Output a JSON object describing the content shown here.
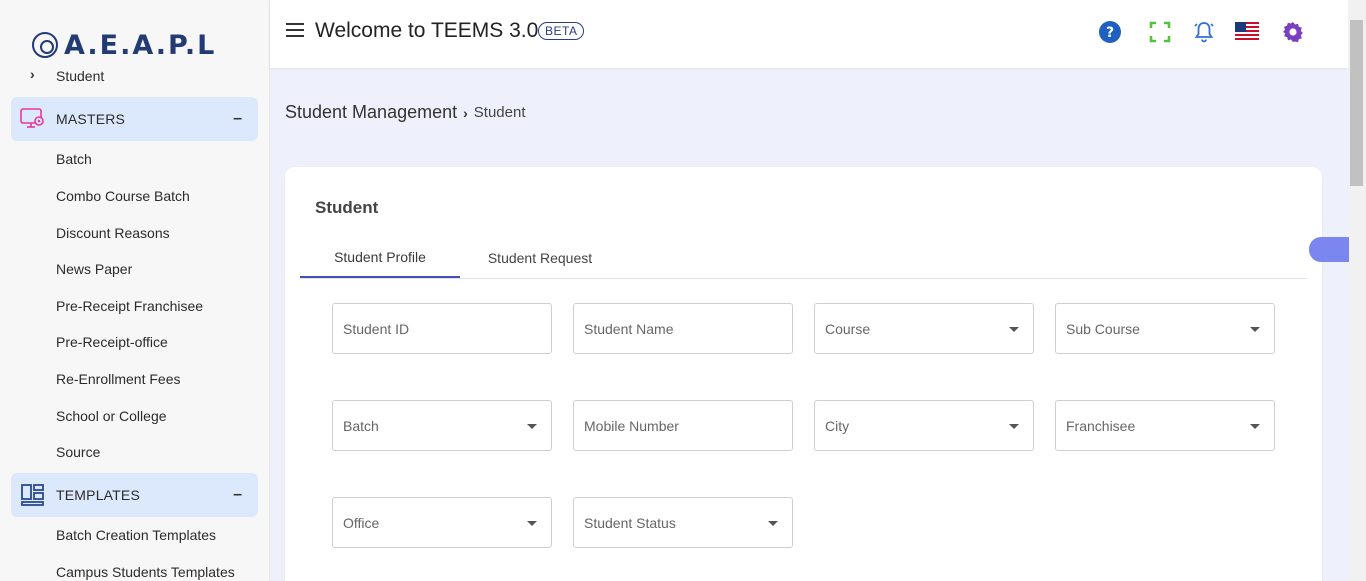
{
  "sidebar": {
    "logo_text": "A.E.A.P.L",
    "top_item": "Student",
    "masters": {
      "label": "MASTERS",
      "collapse": "–",
      "items": [
        "Batch",
        "Combo Course Batch",
        "Discount Reasons",
        "News Paper",
        "Pre-Receipt Franchisee",
        "Pre-Receipt-office",
        "Re-Enrollment Fees",
        "School or College",
        "Source"
      ]
    },
    "templates": {
      "label": "TEMPLATES",
      "collapse": "–",
      "items": [
        "Batch Creation Templates",
        "Campus Students Templates"
      ]
    }
  },
  "header": {
    "title": "Welcome to TEEMS 3.0",
    "badge": "BETA",
    "icons": [
      "help-icon",
      "fullscreen-icon",
      "notification-icon",
      "us-flag-icon",
      "settings-icon"
    ]
  },
  "breadcrumb": {
    "root": "Student Management",
    "current": "Student"
  },
  "card": {
    "title": "Student",
    "tabs": [
      "Student Profile",
      "Student Request"
    ],
    "active_tab": "Student Profile",
    "fields": [
      {
        "placeholder": "Student ID",
        "type": "input"
      },
      {
        "placeholder": "Student Name",
        "type": "input"
      },
      {
        "placeholder": "Course",
        "type": "select"
      },
      {
        "placeholder": "Sub Course",
        "type": "select"
      },
      {
        "placeholder": "Batch",
        "type": "select"
      },
      {
        "placeholder": "Mobile Number",
        "type": "input"
      },
      {
        "placeholder": "City",
        "type": "select"
      },
      {
        "placeholder": "Franchisee",
        "type": "select"
      },
      {
        "placeholder": "Office",
        "type": "select"
      },
      {
        "placeholder": "Student Status",
        "type": "select"
      }
    ]
  },
  "colors": {
    "accent": "#3f51b5",
    "section_bg": "#dce8fb",
    "help": "#1f5fbf",
    "fullscreen": "#5bbf3f",
    "notification": "#2f6fd6",
    "settings": "#7a3fc0"
  }
}
